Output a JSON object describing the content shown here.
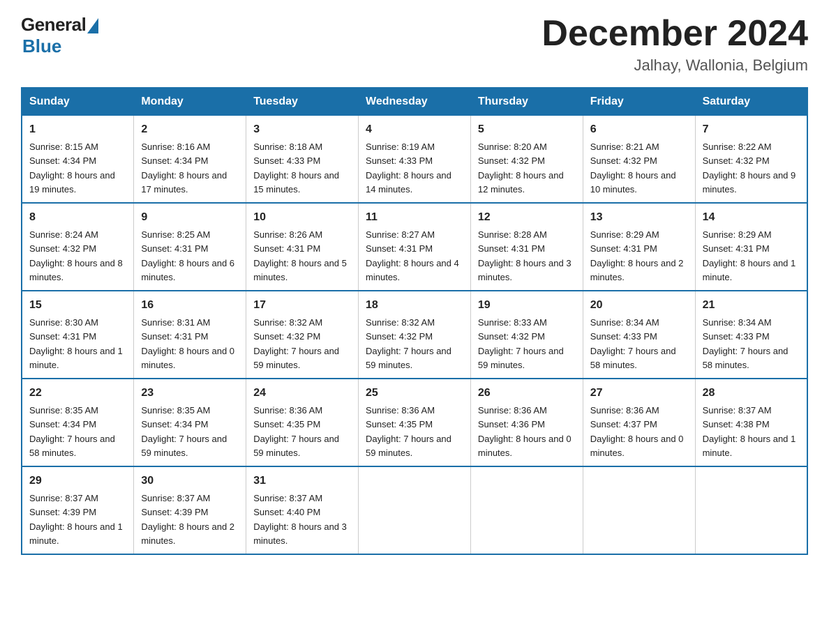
{
  "header": {
    "logo_general": "General",
    "logo_blue": "Blue",
    "month_title": "December 2024",
    "location": "Jalhay, Wallonia, Belgium"
  },
  "days_of_week": [
    "Sunday",
    "Monday",
    "Tuesday",
    "Wednesday",
    "Thursday",
    "Friday",
    "Saturday"
  ],
  "weeks": [
    [
      {
        "day": "1",
        "sunrise": "8:15 AM",
        "sunset": "4:34 PM",
        "daylight": "8 hours and 19 minutes."
      },
      {
        "day": "2",
        "sunrise": "8:16 AM",
        "sunset": "4:34 PM",
        "daylight": "8 hours and 17 minutes."
      },
      {
        "day": "3",
        "sunrise": "8:18 AM",
        "sunset": "4:33 PM",
        "daylight": "8 hours and 15 minutes."
      },
      {
        "day": "4",
        "sunrise": "8:19 AM",
        "sunset": "4:33 PM",
        "daylight": "8 hours and 14 minutes."
      },
      {
        "day": "5",
        "sunrise": "8:20 AM",
        "sunset": "4:32 PM",
        "daylight": "8 hours and 12 minutes."
      },
      {
        "day": "6",
        "sunrise": "8:21 AM",
        "sunset": "4:32 PM",
        "daylight": "8 hours and 10 minutes."
      },
      {
        "day": "7",
        "sunrise": "8:22 AM",
        "sunset": "4:32 PM",
        "daylight": "8 hours and 9 minutes."
      }
    ],
    [
      {
        "day": "8",
        "sunrise": "8:24 AM",
        "sunset": "4:32 PM",
        "daylight": "8 hours and 8 minutes."
      },
      {
        "day": "9",
        "sunrise": "8:25 AM",
        "sunset": "4:31 PM",
        "daylight": "8 hours and 6 minutes."
      },
      {
        "day": "10",
        "sunrise": "8:26 AM",
        "sunset": "4:31 PM",
        "daylight": "8 hours and 5 minutes."
      },
      {
        "day": "11",
        "sunrise": "8:27 AM",
        "sunset": "4:31 PM",
        "daylight": "8 hours and 4 minutes."
      },
      {
        "day": "12",
        "sunrise": "8:28 AM",
        "sunset": "4:31 PM",
        "daylight": "8 hours and 3 minutes."
      },
      {
        "day": "13",
        "sunrise": "8:29 AM",
        "sunset": "4:31 PM",
        "daylight": "8 hours and 2 minutes."
      },
      {
        "day": "14",
        "sunrise": "8:29 AM",
        "sunset": "4:31 PM",
        "daylight": "8 hours and 1 minute."
      }
    ],
    [
      {
        "day": "15",
        "sunrise": "8:30 AM",
        "sunset": "4:31 PM",
        "daylight": "8 hours and 1 minute."
      },
      {
        "day": "16",
        "sunrise": "8:31 AM",
        "sunset": "4:31 PM",
        "daylight": "8 hours and 0 minutes."
      },
      {
        "day": "17",
        "sunrise": "8:32 AM",
        "sunset": "4:32 PM",
        "daylight": "7 hours and 59 minutes."
      },
      {
        "day": "18",
        "sunrise": "8:32 AM",
        "sunset": "4:32 PM",
        "daylight": "7 hours and 59 minutes."
      },
      {
        "day": "19",
        "sunrise": "8:33 AM",
        "sunset": "4:32 PM",
        "daylight": "7 hours and 59 minutes."
      },
      {
        "day": "20",
        "sunrise": "8:34 AM",
        "sunset": "4:33 PM",
        "daylight": "7 hours and 58 minutes."
      },
      {
        "day": "21",
        "sunrise": "8:34 AM",
        "sunset": "4:33 PM",
        "daylight": "7 hours and 58 minutes."
      }
    ],
    [
      {
        "day": "22",
        "sunrise": "8:35 AM",
        "sunset": "4:34 PM",
        "daylight": "7 hours and 58 minutes."
      },
      {
        "day": "23",
        "sunrise": "8:35 AM",
        "sunset": "4:34 PM",
        "daylight": "7 hours and 59 minutes."
      },
      {
        "day": "24",
        "sunrise": "8:36 AM",
        "sunset": "4:35 PM",
        "daylight": "7 hours and 59 minutes."
      },
      {
        "day": "25",
        "sunrise": "8:36 AM",
        "sunset": "4:35 PM",
        "daylight": "7 hours and 59 minutes."
      },
      {
        "day": "26",
        "sunrise": "8:36 AM",
        "sunset": "4:36 PM",
        "daylight": "8 hours and 0 minutes."
      },
      {
        "day": "27",
        "sunrise": "8:36 AM",
        "sunset": "4:37 PM",
        "daylight": "8 hours and 0 minutes."
      },
      {
        "day": "28",
        "sunrise": "8:37 AM",
        "sunset": "4:38 PM",
        "daylight": "8 hours and 1 minute."
      }
    ],
    [
      {
        "day": "29",
        "sunrise": "8:37 AM",
        "sunset": "4:39 PM",
        "daylight": "8 hours and 1 minute."
      },
      {
        "day": "30",
        "sunrise": "8:37 AM",
        "sunset": "4:39 PM",
        "daylight": "8 hours and 2 minutes."
      },
      {
        "day": "31",
        "sunrise": "8:37 AM",
        "sunset": "4:40 PM",
        "daylight": "8 hours and 3 minutes."
      },
      null,
      null,
      null,
      null
    ]
  ]
}
